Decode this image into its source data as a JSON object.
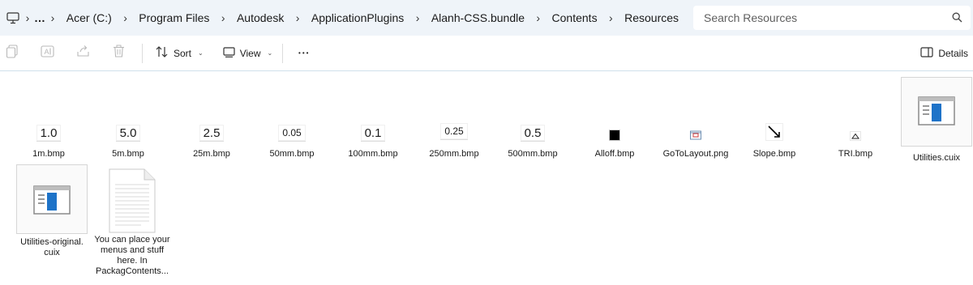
{
  "address": {
    "overflow": "…",
    "crumbs": [
      "Acer (C:)",
      "Program Files",
      "Autodesk",
      "ApplicationPlugins",
      "Alanh-CSS.bundle",
      "Contents",
      "Resources"
    ]
  },
  "search": {
    "placeholder": "Search Resources"
  },
  "toolbar": {
    "sort_label": "Sort",
    "view_label": "View",
    "more_label": "•••",
    "details_label": "Details"
  },
  "files": [
    {
      "name": "1m.bmp",
      "thumb_text": "1.0"
    },
    {
      "name": "5m.bmp",
      "thumb_text": "5.0"
    },
    {
      "name": "25m.bmp",
      "thumb_text": "2.5"
    },
    {
      "name": "50mm.bmp",
      "thumb_text": "0.05"
    },
    {
      "name": "100mm.bmp",
      "thumb_text": "0.1"
    },
    {
      "name": "250mm.bmp",
      "thumb_text": "0.25"
    },
    {
      "name": "500mm.bmp",
      "thumb_text": "0.5"
    },
    {
      "name": "Alloff.bmp"
    },
    {
      "name": "GoToLayout.png"
    },
    {
      "name": "Slope.bmp"
    },
    {
      "name": "TRI.bmp"
    },
    {
      "name": "Utilities.cuix"
    },
    {
      "name": "Utilities-original.\ncuix"
    },
    {
      "name": "You can place your menus and stuff here.  In PackagContents..."
    }
  ],
  "colors": {
    "addr_bg": "#eff4f9",
    "accent": "#1e73c8",
    "divider": "#cfe0eb"
  }
}
